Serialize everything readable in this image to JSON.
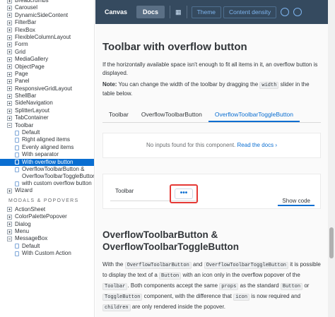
{
  "sidebar": {
    "items_top": [
      {
        "label": "Breadcrumbs",
        "kind": "expandable"
      },
      {
        "label": "Carousel",
        "kind": "expandable"
      },
      {
        "label": "DynamicSideContent",
        "kind": "expandable"
      },
      {
        "label": "FilterBar",
        "kind": "expandable"
      },
      {
        "label": "FlexBox",
        "kind": "expandable"
      },
      {
        "label": "FlexibleColumnLayout",
        "kind": "expandable"
      },
      {
        "label": "Form",
        "kind": "expandable"
      },
      {
        "label": "Grid",
        "kind": "expandable"
      },
      {
        "label": "MediaGallery",
        "kind": "expandable"
      },
      {
        "label": "ObjectPage",
        "kind": "expandable"
      },
      {
        "label": "Page",
        "kind": "expandable"
      },
      {
        "label": "Panel",
        "kind": "expandable"
      },
      {
        "label": "ResponsiveGridLayout",
        "kind": "expandable"
      },
      {
        "label": "ShellBar",
        "kind": "expandable"
      },
      {
        "label": "SideNavigation",
        "kind": "expandable"
      },
      {
        "label": "SplitterLayout",
        "kind": "expandable"
      },
      {
        "label": "TabContainer",
        "kind": "expandable"
      },
      {
        "label": "Toolbar",
        "kind": "expanded"
      },
      {
        "label": "Default",
        "kind": "story"
      },
      {
        "label": "Right aligned items",
        "kind": "story"
      },
      {
        "label": "Evenly aligned items",
        "kind": "story"
      },
      {
        "label": "With separator",
        "kind": "story"
      },
      {
        "label": "With overflow button",
        "kind": "story",
        "selected": true
      },
      {
        "label": "OverflowToolbarButton & OverflowToolbarToggleButton",
        "kind": "story",
        "two_line": true
      },
      {
        "label": "with custom overflow button",
        "kind": "story"
      },
      {
        "label": "Wizard",
        "kind": "expandable"
      }
    ],
    "group_header": "MODALS & POPOVERS",
    "items_bottom": [
      {
        "label": "ActionSheet",
        "kind": "expandable"
      },
      {
        "label": "ColorPalettePopover",
        "kind": "expandable"
      },
      {
        "label": "Dialog",
        "kind": "expandable"
      },
      {
        "label": "Menu",
        "kind": "expandable"
      },
      {
        "label": "MessageBox",
        "kind": "expanded"
      },
      {
        "label": "Default",
        "kind": "story"
      },
      {
        "label": "With Custom Action",
        "kind": "story"
      }
    ]
  },
  "topbar": {
    "tabs": [
      "Canvas",
      "Docs"
    ],
    "active_tab": "Docs",
    "buttons": [
      "Theme",
      "Content density"
    ]
  },
  "main": {
    "title": "Toolbar with overflow button",
    "description": "If the horizontally available space isn't enough to fit all items in it, an overflow button is displayed.",
    "note_bold": "Note:",
    "note_before": " You can change the width of the toolbar by dragging the ",
    "note_code": "width",
    "note_after": " slider in the table below.",
    "tabs": [
      "Toolbar",
      "OverflowToolbarButton",
      "OverflowToolbarToggleButton"
    ],
    "active_tab_index": 2,
    "no_inputs_text": "No inputs found for this component.",
    "read_docs_link": "Read the docs ›",
    "demo_toolbar_label": "Toolbar",
    "overflow_button_text": "•••",
    "show_code_label": "Show code",
    "section_title": "OverflowToolbarButton & OverflowToolbarToggleButton",
    "para": [
      {
        "t": "With the "
      },
      {
        "c": "OverflowToolbarButton"
      },
      {
        "t": " and "
      },
      {
        "c": "OverflowToolbarToggleButton"
      },
      {
        "t": " it is possible to display the text of a "
      },
      {
        "c": "Button"
      },
      {
        "t": " with an icon only in the overflow popover of the "
      },
      {
        "c": "Toolbar"
      },
      {
        "t": ". Both components accept the same "
      },
      {
        "c": "props"
      },
      {
        "t": " as the standard "
      },
      {
        "c": "Button"
      },
      {
        "t": " or "
      },
      {
        "c": "ToggleButton"
      },
      {
        "t": " component, with the difference that "
      },
      {
        "c": "icon"
      },
      {
        "t": " is now required and "
      },
      {
        "c": "children"
      },
      {
        "t": " are only rendered inside the popover."
      }
    ]
  },
  "colors": {
    "accent": "#0a6ed1",
    "topbar": "#354a5f",
    "highlight": "#e53935"
  }
}
